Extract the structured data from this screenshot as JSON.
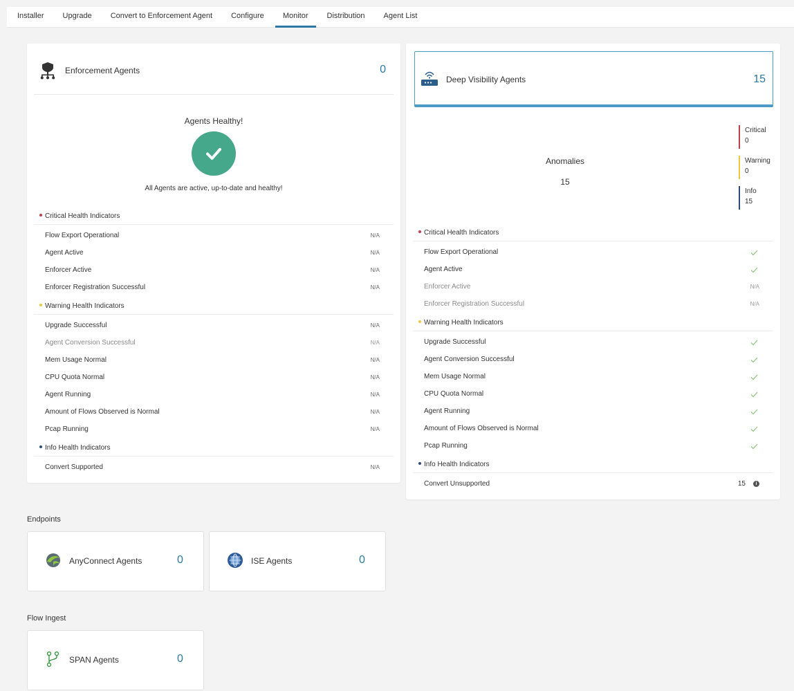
{
  "tabs": [
    {
      "label": "Installer"
    },
    {
      "label": "Upgrade"
    },
    {
      "label": "Convert to Enforcement Agent"
    },
    {
      "label": "Configure"
    },
    {
      "label": "Monitor",
      "active": true
    },
    {
      "label": "Distribution"
    },
    {
      "label": "Agent List"
    }
  ],
  "colors": {
    "accent": "#2b78a6",
    "healthy": "#45a88a",
    "critical": "#c63d4a",
    "warning": "#f0c63d",
    "info": "#2d4a7a",
    "check": "#8ac27a"
  },
  "enforcement": {
    "title": "Enforcement Agents",
    "count": "0",
    "icon": "enforcement-agent-icon",
    "healthy_title": "Agents Healthy!",
    "healthy_sub": "All Agents are active, up-to-date and healthy!",
    "critical_label": "Critical Health Indicators",
    "critical": [
      {
        "label": "Flow Export Operational",
        "value": "N/A"
      },
      {
        "label": "Agent Active",
        "value": "N/A"
      },
      {
        "label": "Enforcer Active",
        "value": "N/A"
      },
      {
        "label": "Enforcer Registration Successful",
        "value": "N/A"
      }
    ],
    "warning_label": "Warning Health Indicators",
    "warning": [
      {
        "label": "Upgrade Successful",
        "value": "N/A"
      },
      {
        "label": "Agent Conversion Successful",
        "value": "N/A"
      },
      {
        "label": "Mem Usage Normal",
        "value": "N/A"
      },
      {
        "label": "CPU Quota Normal",
        "value": "N/A"
      },
      {
        "label": "Agent Running",
        "value": "N/A"
      },
      {
        "label": "Amount of Flows Observed is Normal",
        "value": "N/A"
      },
      {
        "label": "Pcap Running",
        "value": "N/A"
      }
    ],
    "info_label": "Info Health Indicators",
    "info": [
      {
        "label": "Convert Supported",
        "value": "N/A"
      }
    ]
  },
  "deep_visibility": {
    "title": "Deep Visibility Agents",
    "count": "15",
    "icon": "deep-visibility-agent-icon",
    "anomalies_label": "Anomalies",
    "anomalies_count": "15",
    "severity": [
      {
        "label": "Critical",
        "count": "0"
      },
      {
        "label": "Warning",
        "count": "0"
      },
      {
        "label": "Info",
        "count": "15"
      }
    ],
    "critical_label": "Critical Health Indicators",
    "critical": [
      {
        "label": "Flow Export Operational",
        "status": "check"
      },
      {
        "label": "Agent Active",
        "status": "check"
      },
      {
        "label": "Enforcer Active",
        "value": "N/A"
      },
      {
        "label": "Enforcer Registration Successful",
        "value": "N/A"
      }
    ],
    "warning_label": "Warning Health Indicators",
    "warning": [
      {
        "label": "Upgrade Successful",
        "status": "check"
      },
      {
        "label": "Agent Conversion Successful",
        "status": "check"
      },
      {
        "label": "Mem Usage Normal",
        "status": "check"
      },
      {
        "label": "CPU Quota Normal",
        "status": "check"
      },
      {
        "label": "Agent Running",
        "status": "check"
      },
      {
        "label": "Amount of Flows Observed is Normal",
        "status": "check"
      },
      {
        "label": "Pcap Running",
        "status": "check"
      }
    ],
    "info_label": "Info Health Indicators",
    "info": [
      {
        "label": "Convert Unsupported",
        "count": "15"
      }
    ]
  },
  "endpoints": {
    "label": "Endpoints",
    "anyconnect": {
      "name": "AnyConnect Agents",
      "count": "0",
      "icon": "anyconnect-icon"
    },
    "ise": {
      "name": "ISE Agents",
      "count": "0",
      "icon": "ise-globe-icon"
    }
  },
  "flow_ingest": {
    "label": "Flow Ingest",
    "span": {
      "name": "SPAN Agents",
      "count": "0",
      "icon": "span-branch-icon"
    }
  }
}
